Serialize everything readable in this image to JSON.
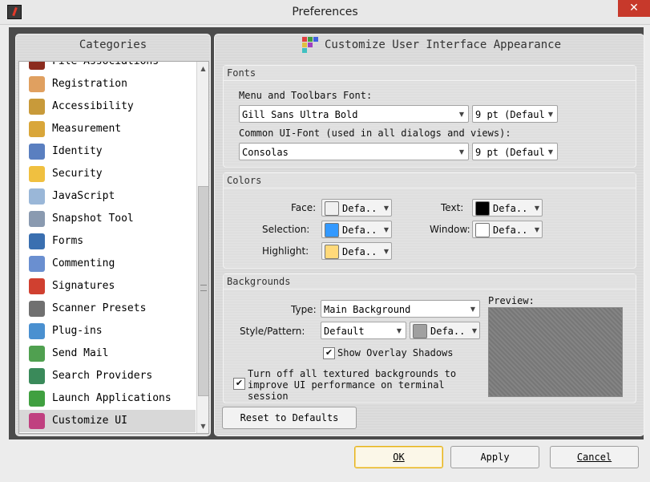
{
  "window": {
    "title": "Preferences",
    "close_glyph": "✕"
  },
  "categories": {
    "header": "Categories",
    "items": [
      {
        "label": "File Associations",
        "icon": "file-associations-icon",
        "color": "#8b2b1e"
      },
      {
        "label": "Registration",
        "icon": "registration-icon",
        "color": "#e0a060"
      },
      {
        "label": "Accessibility",
        "icon": "accessibility-icon",
        "color": "#c89a3a"
      },
      {
        "label": "Measurement",
        "icon": "measurement-icon",
        "color": "#d9a63a"
      },
      {
        "label": "Identity",
        "icon": "identity-icon",
        "color": "#5a7fc0"
      },
      {
        "label": "Security",
        "icon": "security-icon",
        "color": "#f0c040"
      },
      {
        "label": "JavaScript",
        "icon": "javascript-icon",
        "color": "#9ab7d8"
      },
      {
        "label": "Snapshot Tool",
        "icon": "snapshot-icon",
        "color": "#8a9ab0"
      },
      {
        "label": "Forms",
        "icon": "forms-icon",
        "color": "#3a6fb0"
      },
      {
        "label": "Commenting",
        "icon": "commenting-icon",
        "color": "#6a8fd0"
      },
      {
        "label": "Signatures",
        "icon": "signatures-icon",
        "color": "#d04030"
      },
      {
        "label": "Scanner Presets",
        "icon": "scanner-icon",
        "color": "#707070"
      },
      {
        "label": "Plug-ins",
        "icon": "plugins-icon",
        "color": "#4a90d0"
      },
      {
        "label": "Send Mail",
        "icon": "send-mail-icon",
        "color": "#50a050"
      },
      {
        "label": "Search Providers",
        "icon": "search-providers-icon",
        "color": "#3a8a5a"
      },
      {
        "label": "Launch Applications",
        "icon": "launch-icon",
        "color": "#40a040"
      },
      {
        "label": "Customize UI",
        "icon": "customize-ui-icon",
        "color": "#c04080"
      }
    ],
    "selected": "Customize UI"
  },
  "main": {
    "title": "Customize User Interface Appearance",
    "fonts": {
      "section": "Fonts",
      "menu_font_label": "Menu and Toolbars Font:",
      "menu_font_value": "Gill Sans Ultra Bold",
      "menu_size_value": "9 pt (Defaul",
      "ui_font_label": "Common UI-Font (used in all dialogs and views):",
      "ui_font_value": "Consolas",
      "ui_size_value": "9 pt (Defaul"
    },
    "colors": {
      "section": "Colors",
      "face_label": "Face:",
      "face_value": "Defa..",
      "face_color": "#f0f0f0",
      "selection_label": "Selection:",
      "selection_value": "Defa..",
      "selection_color": "#3399ff",
      "highlight_label": "Highlight:",
      "highlight_value": "Defa..",
      "highlight_color": "#ffd97a",
      "text_label": "Text:",
      "text_value": "Defa..",
      "text_color": "#000000",
      "window_label": "Window:",
      "window_value": "Defa..",
      "window_color": "#ffffff"
    },
    "backgrounds": {
      "section": "Backgrounds",
      "type_label": "Type:",
      "type_value": "Main Background",
      "style_label": "Style/Pattern:",
      "style_value": "Default",
      "pattern_color_value": "Defa..",
      "pattern_color": "#a0a0a0",
      "overlay_label": "Show Overlay Shadows",
      "overlay_checked": true,
      "textured_label_1": "Turn off all textured backgrounds to",
      "textured_label_2": "improve UI performance on terminal",
      "textured_label_3": "session",
      "textured_checked": true,
      "preview_label": "Preview:"
    },
    "reset_label": "Reset to Defaults"
  },
  "footer": {
    "ok_label": "OK",
    "apply_label": "Apply",
    "cancel_label": "Cancel"
  }
}
